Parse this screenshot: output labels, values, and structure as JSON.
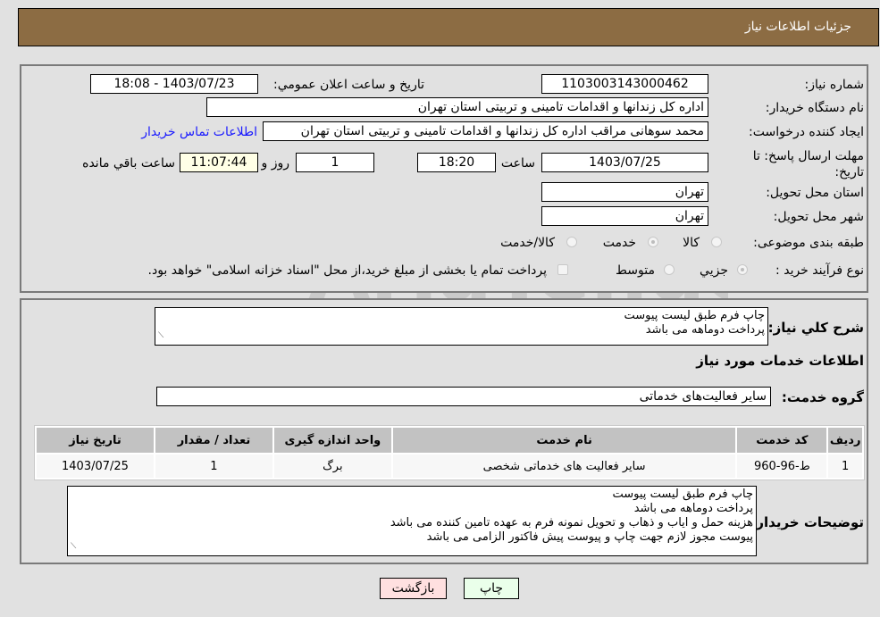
{
  "header": {
    "title": "جزئیات اطلاعات نیاز"
  },
  "form": {
    "need_number": {
      "label": "شماره نیاز:",
      "value": "1103003143000462"
    },
    "announce_datetime": {
      "label": "تاریخ و ساعت اعلان عمومي:",
      "value": "1403/07/23 - 18:08"
    },
    "buyer_org": {
      "label": "نام دستگاه خریدار:",
      "value": "اداره کل زندانها و اقدامات تامینی و تربیتی استان تهران"
    },
    "requester": {
      "label": "ایجاد کننده درخواست:",
      "value": "محمد سوهانی مراقب  اداره کل زندانها و اقدامات تامینی و تربیتی استان تهران",
      "contact_link": "اطلاعات تماس خریدار"
    },
    "deadline": {
      "label": "مهلت ارسال پاسخ: تا تاریخ:",
      "date": "1403/07/25",
      "time_label": "ساعت",
      "time": "18:20",
      "days": "1",
      "days_label": "روز و",
      "remaining": "11:07:44",
      "remaining_label": "ساعت باقي مانده"
    },
    "province": {
      "label": "استان محل تحویل:",
      "value": "تهران"
    },
    "city": {
      "label": "شهر محل تحویل:",
      "value": "تهران"
    },
    "category": {
      "label": "طبقه بندی موضوعی:",
      "options": [
        "کالا",
        "خدمت",
        "کالا/خدمت"
      ],
      "selected": "خدمت"
    },
    "purchase_type": {
      "label": "نوع فرآیند خرید :",
      "options": [
        "جزيي",
        "متوسط"
      ],
      "selected": "جزيي",
      "treasury_note": "پرداخت تمام یا بخشی از مبلغ خرید،از محل \"اسناد خزانه اسلامی\" خواهد بود."
    }
  },
  "summary": {
    "label": "شرح کلي نياز:",
    "lines": [
      "چاپ فرم طبق لیست پیوست",
      "پرداخت دوماهه می باشد"
    ]
  },
  "services_section": {
    "title": "اطلاعات خدمات مورد نیاز",
    "group_label": "گروه خدمت:",
    "group_value": "سایر فعالیت‌های خدماتی"
  },
  "table": {
    "headers": [
      "ردیف",
      "کد خدمت",
      "نام خدمت",
      "واحد اندازه گیری",
      "تعداد / مقدار",
      "تاریخ نیاز"
    ],
    "rows": [
      [
        "1",
        "ط-96-960",
        "سایر فعالیت های خدماتی شخصی",
        "برگ",
        "1",
        "1403/07/25"
      ]
    ]
  },
  "buyer_notes": {
    "label": "توضیحات خریدار:",
    "lines": [
      "چاپ فرم طبق لیست پیوست",
      "پرداخت دوماهه می باشد",
      "هزینه حمل و ایاب و ذهاب و تحویل نمونه فرم به عهده تامین کننده می باشد",
      "پیوست مجوز لازم جهت چاپ و پیوست پیش فاکتور الزامی می باشد"
    ]
  },
  "buttons": {
    "print": "چاپ",
    "back": "بازگشت"
  },
  "watermark": {
    "text": "AriaTender.neT"
  },
  "colors": {
    "header_bg": "#8c6c43",
    "link": "#1a1aff",
    "print_bg": "#eaffea",
    "back_bg": "#ffe0e0"
  }
}
